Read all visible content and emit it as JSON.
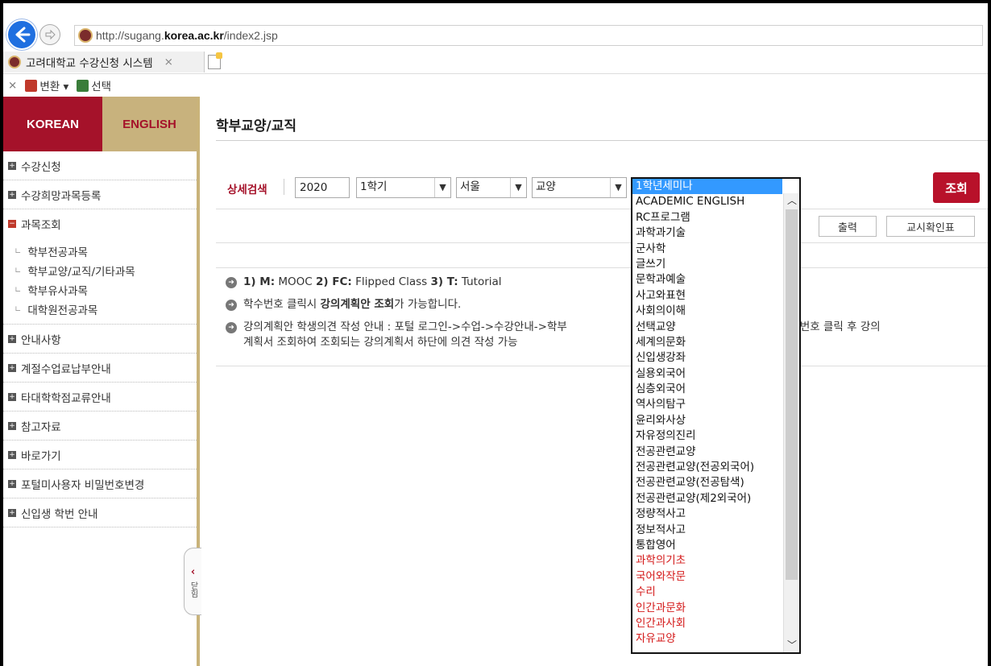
{
  "browser": {
    "url_prefix": "http://sugang.",
    "url_domain": "korea.ac.kr",
    "url_suffix": "/index2.jsp",
    "tab_title": "고려대학교 수강신청 시스템",
    "tab_close": "×",
    "toolbar_close": "×",
    "convert_label": "변환",
    "dropdown_caret": "▾",
    "select_label": "선택"
  },
  "sidebar": {
    "lang_korean": "KOREAN",
    "lang_english": "ENGLISH",
    "items": [
      {
        "label": "수강신청",
        "icon": "plus-box-icon"
      },
      {
        "label": "수강희망과목등록",
        "icon": "plus-box-icon"
      },
      {
        "label": "과목조회",
        "icon": "minus-box-icon"
      },
      {
        "label": "안내사항",
        "icon": "plus-box-icon"
      },
      {
        "label": "계절수업료납부안내",
        "icon": "plus-box-icon"
      },
      {
        "label": "타대학학점교류안내",
        "icon": "plus-box-icon"
      },
      {
        "label": "참고자료",
        "icon": "plus-box-icon"
      },
      {
        "label": "바로가기",
        "icon": "plus-box-icon"
      },
      {
        "label": "포털미사용자 비밀번호변경",
        "icon": "plus-box-icon"
      },
      {
        "label": "신입생 학번 안내",
        "icon": "plus-box-icon"
      }
    ],
    "sub_items": [
      "학부전공과목",
      "학부교양/교직/기타과목",
      "학부유사과목",
      "대학원전공과목"
    ],
    "toggle_arrow": "‹",
    "toggle_label": "닫힘"
  },
  "main": {
    "title": "학부교양/교직",
    "search_label": "상세검색",
    "year": "2020",
    "term": "1학기",
    "campus": "서울",
    "category": "교양",
    "search_button": "조회",
    "print_button": "출력",
    "timetable_button": "교시확인표",
    "notices": [
      {
        "parts": [
          "1) M:",
          " MOOC  ",
          "2) FC:",
          " Flipped Class  ",
          "3) T:",
          " Tutorial"
        ]
      },
      {
        "parts": [
          "학수번호 클릭시 ",
          "강의계획안 조회",
          "가 가능합니다."
        ]
      },
      {
        "parts": [
          "강의계획안 학생의견 작성 안내 : 포털 로그인->수업->수강안내->학부",
          "해당 과목 학수번호 클릭 후 강의",
          "계획서 조회하여 조회되는 강의계획서 하단에 의견 작성 가능"
        ]
      }
    ]
  },
  "dropdown": {
    "options": [
      {
        "label": "1학년세미나",
        "red": false,
        "selected": true
      },
      {
        "label": "ACADEMIC ENGLISH",
        "red": false
      },
      {
        "label": "RC프로그램",
        "red": false
      },
      {
        "label": "과학과기술",
        "red": false
      },
      {
        "label": "군사학",
        "red": false
      },
      {
        "label": "글쓰기",
        "red": false
      },
      {
        "label": "문학과예술",
        "red": false
      },
      {
        "label": "사고와표현",
        "red": false
      },
      {
        "label": "사회의이해",
        "red": false
      },
      {
        "label": "선택교양",
        "red": false
      },
      {
        "label": "세계의문화",
        "red": false
      },
      {
        "label": "신입생강좌",
        "red": false
      },
      {
        "label": "실용외국어",
        "red": false
      },
      {
        "label": "심층외국어",
        "red": false
      },
      {
        "label": "역사의탐구",
        "red": false
      },
      {
        "label": "윤리와사상",
        "red": false
      },
      {
        "label": "자유정의진리",
        "red": false
      },
      {
        "label": "전공관련교양",
        "red": false
      },
      {
        "label": "전공관련교양(전공외국어)",
        "red": false
      },
      {
        "label": "전공관련교양(전공탐색)",
        "red": false
      },
      {
        "label": "전공관련교양(제2외국어)",
        "red": false
      },
      {
        "label": "정량적사고",
        "red": false
      },
      {
        "label": "정보적사고",
        "red": false
      },
      {
        "label": "통합영어",
        "red": false
      },
      {
        "label": "과학의기초",
        "red": true
      },
      {
        "label": "국어와작문",
        "red": true
      },
      {
        "label": "수리",
        "red": true
      },
      {
        "label": "인간과문화",
        "red": true
      },
      {
        "label": "인간과사회",
        "red": true
      },
      {
        "label": "자유교양",
        "red": true
      }
    ],
    "scroll_up": "︿",
    "scroll_down": "﹀"
  },
  "colors": {
    "brand_red": "#a5122a",
    "brand_gold": "#c8b27d",
    "selection_blue": "#3399ff",
    "option_red": "#d41a1a"
  }
}
